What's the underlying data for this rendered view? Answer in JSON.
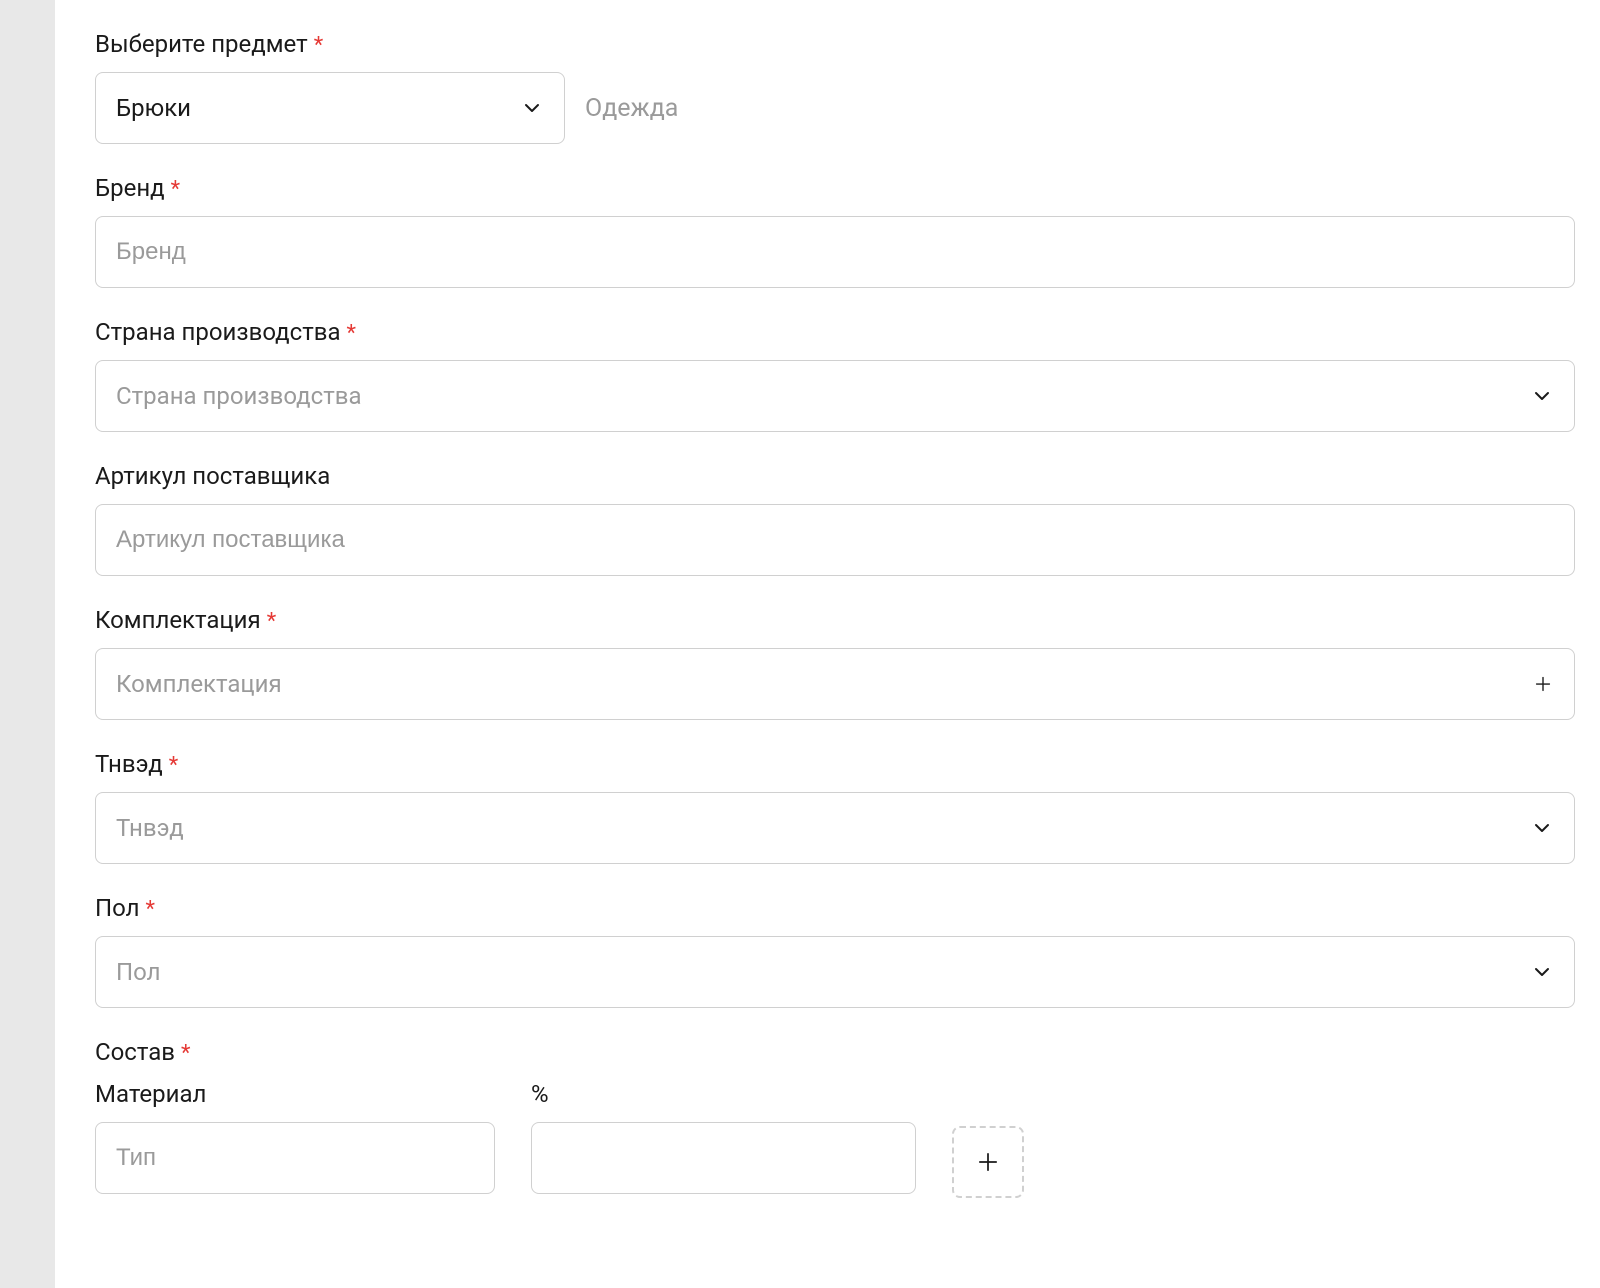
{
  "fields": {
    "item_select": {
      "label": "Выберите предмет",
      "value": "Брюки",
      "category": "Одежда"
    },
    "brand": {
      "label": "Бренд",
      "placeholder": "Бренд"
    },
    "country": {
      "label": "Страна производства",
      "placeholder": "Страна производства"
    },
    "supplier_article": {
      "label": "Артикул поставщика",
      "placeholder": "Артикул поставщика"
    },
    "equipment": {
      "label": "Комплектация",
      "placeholder": "Комплектация"
    },
    "tnved": {
      "label": "Тнвэд",
      "placeholder": "Тнвэд"
    },
    "gender": {
      "label": "Пол",
      "placeholder": "Пол"
    },
    "composition": {
      "label": "Состав",
      "material_label": "Материал",
      "percent_label": "%",
      "material_placeholder": "Тип"
    }
  }
}
